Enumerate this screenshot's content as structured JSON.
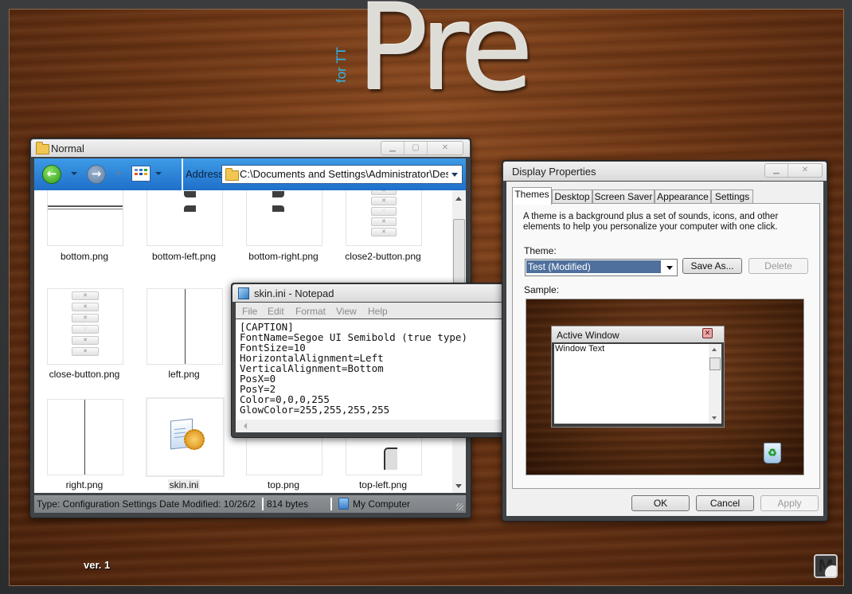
{
  "desktop": {
    "logo_main": "Pre",
    "logo_sub": "for TT",
    "version": "ver. 1",
    "corner_logo": "M",
    "accent_color": "#2fb5ea"
  },
  "explorer": {
    "title": "Normal",
    "address_label": "Address",
    "address_value": "C:\\Documents and Settings\\Administrator\\Deskt",
    "icons": {
      "back": "back-arrow-icon",
      "forward": "forward-arrow-icon",
      "views": "views-icon",
      "folder": "folder-icon"
    },
    "files": [
      {
        "name": "bottom.png"
      },
      {
        "name": "bottom-left.png"
      },
      {
        "name": "bottom-right.png"
      },
      {
        "name": "close2-button.png"
      },
      {
        "name": "close-button.png"
      },
      {
        "name": "left.png"
      },
      {
        "name": "right.png"
      },
      {
        "name": "skin.ini",
        "selected": true
      },
      {
        "name": "top.png"
      },
      {
        "name": "top-left.png"
      }
    ],
    "status": {
      "details": "Type: Configuration Settings Date Modified: 10/26/2",
      "size": "814 bytes",
      "location": "My Computer"
    }
  },
  "notepad": {
    "title": "skin.ini - Notepad",
    "menu": [
      "File",
      "Edit",
      "Format",
      "View",
      "Help"
    ],
    "content": "[CAPTION]\nFontName=Segoe UI Semibold (true type)\nFontSize=10\nHorizontalAlignment=Left\nVerticalAlignment=Bottom\nPosX=0\nPosY=2\nColor=0,0,0,255\nGlowColor=255,255,255,255"
  },
  "display_properties": {
    "title": "Display Properties",
    "tabs": [
      "Themes",
      "Desktop",
      "Screen Saver",
      "Appearance",
      "Settings"
    ],
    "active_tab": "Themes",
    "description": "A theme is a background plus a set of sounds, icons, and other elements to help you personalize your computer with one click.",
    "theme_label": "Theme:",
    "theme_selected": "Test (Modified)",
    "save_as_label": "Save As...",
    "delete_label": "Delete",
    "sample_label": "Sample:",
    "sample": {
      "active_window_title": "Active Window",
      "window_text": "Window Text"
    },
    "ok_label": "OK",
    "cancel_label": "Cancel",
    "apply_label": "Apply",
    "selection_color": "#4f709c"
  }
}
